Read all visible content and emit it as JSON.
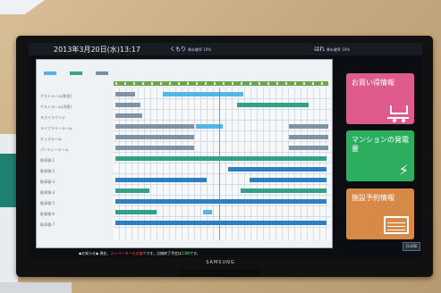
{
  "app": {
    "datetime": "2013年3月20日(水)13:17",
    "weather_left": {
      "label": "くもり",
      "temp": "降水確率 10%"
    },
    "weather_right": {
      "label": "はれ",
      "temp": "降水確率 10%"
    }
  },
  "schedule": {
    "legend": [
      "",
      "",
      ""
    ],
    "rows": [
      {
        "label": "ゲストルーム(和室)"
      },
      {
        "label": "ゲストルーム(洋室)"
      },
      {
        "label": "スカイラウンジ"
      },
      {
        "label": "ライブラリールーム"
      },
      {
        "label": "キッズルーム"
      },
      {
        "label": "パーティールーム"
      },
      {
        "label": "駐車場-1"
      },
      {
        "label": "駐車場-2"
      },
      {
        "label": "駐車場-3"
      },
      {
        "label": "駐車場-4"
      },
      {
        "label": "駐車場-5"
      },
      {
        "label": "駐車場-6"
      },
      {
        "label": "駐車場-7"
      }
    ]
  },
  "tiles": {
    "shopping": "お買い得情報",
    "power": "マンションの発電量",
    "reservation": "施設予約情報"
  },
  "notice": {
    "prefix": "◆お知らせ◆ 現在、",
    "highlight": "エレベーターの点検中",
    "middle": "です。点検終了予定は",
    "time": "13時",
    "suffix": "です。"
  },
  "controls": {
    "close_label": "CLOSE"
  },
  "tv": {
    "brand": "SAMSUNG"
  },
  "colors": {
    "pink": "#df5b8e",
    "green": "#2cae5f",
    "orange": "#d78a47",
    "blue": "#53b7e6",
    "teal": "#33a08a",
    "gray": "#7f93a4"
  }
}
